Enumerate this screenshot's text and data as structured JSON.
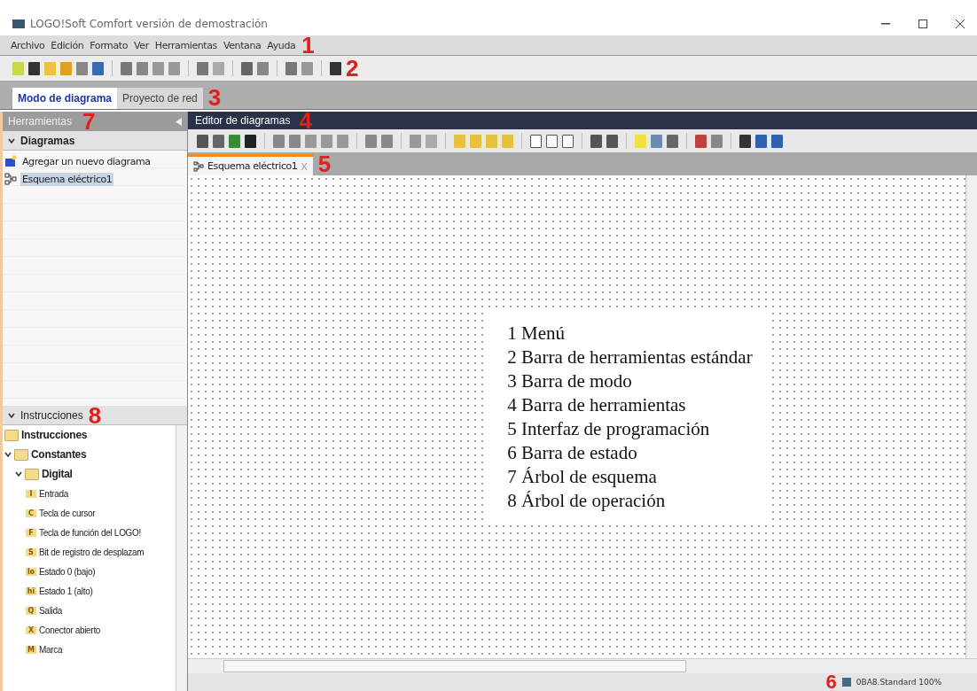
{
  "window": {
    "title": "LOGO!Soft Comfort versión de demostración"
  },
  "menu": {
    "items": [
      "Archivo",
      "Edición",
      "Formato",
      "Ver",
      "Herramientas",
      "Ventana",
      "Ayuda"
    ],
    "callout": "1"
  },
  "toolbar": {
    "callout": "2"
  },
  "mode_tabs": {
    "tabs": [
      {
        "label": "Modo de diagrama",
        "selected": true
      },
      {
        "label": "Proyecto de red",
        "selected": false
      }
    ],
    "callout": "3"
  },
  "tools_panel": {
    "title": "Herramientas",
    "callout": "7",
    "section": {
      "label": "Diagramas",
      "expanded": true
    },
    "items": [
      {
        "label": "Agregar un nuevo diagrama",
        "selected": false,
        "kind": "add"
      },
      {
        "label": "Esquema eléctrico1",
        "selected": true,
        "kind": "diagram"
      }
    ]
  },
  "instructions_panel": {
    "section": {
      "label": "Instrucciones",
      "expanded": true
    },
    "callout": "8",
    "tree": [
      {
        "label": "Instrucciones"
      },
      {
        "label": "Constantes",
        "expanded": true,
        "children": [
          {
            "label": "Digital",
            "expanded": true,
            "children": [
              {
                "badge": "I",
                "label": "Entrada"
              },
              {
                "badge": "C",
                "label": "Tecla de cursor"
              },
              {
                "badge": "F",
                "label": "Tecla de función del LOGO!"
              },
              {
                "badge": "S",
                "label": "Bit de registro de desplazam"
              },
              {
                "badge": "lo",
                "label": "Estado 0 (bajo)"
              },
              {
                "badge": "hi",
                "label": "Estado 1 (alto)"
              },
              {
                "badge": "Q",
                "label": "Salida"
              },
              {
                "badge": "X",
                "label": "Conector abierto"
              },
              {
                "badge": "M",
                "label": "Marca"
              }
            ]
          }
        ]
      }
    ]
  },
  "editor": {
    "title": "Editor de diagramas",
    "callout": "4",
    "tabs": [
      {
        "label": "Esquema eléctrico1",
        "close": "X",
        "selected": true
      }
    ],
    "tab_callout": "5",
    "legend": [
      "1 Menú",
      "2 Barra de herramientas estándar",
      "3 Barra de modo",
      "4 Barra de herramientas",
      "5 Interfaz de programación",
      "6 Barra de estado",
      "7 Árbol de esquema",
      "8 Árbol de operación"
    ]
  },
  "status_bar": {
    "callout": "6",
    "text": "0BA8.Standard 100%"
  }
}
